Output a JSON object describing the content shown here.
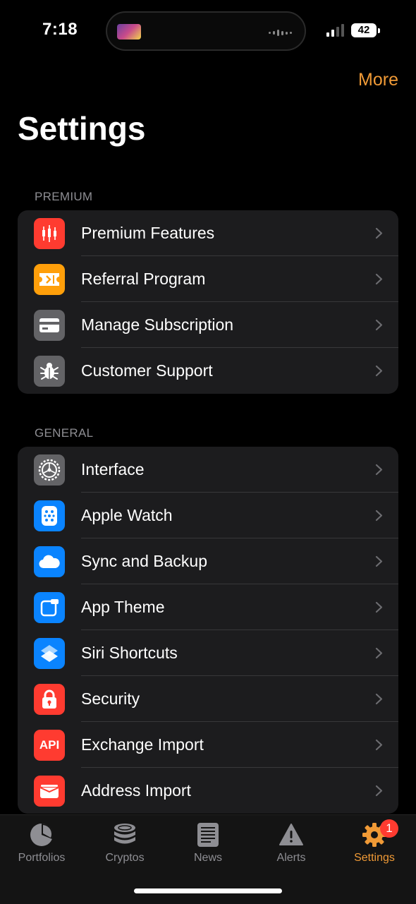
{
  "status_bar": {
    "time": "7:18",
    "battery": "42"
  },
  "header": {
    "more_label": "More",
    "title": "Settings"
  },
  "colors": {
    "accent": "#f09a36",
    "red": "#ff3b30",
    "orange": "#ff9f0a",
    "gray": "#636366",
    "blue": "#0a84ff"
  },
  "sections": {
    "premium": {
      "title": "PREMIUM",
      "items": [
        {
          "label": "Premium Features",
          "icon": "candlestick-chart-icon"
        },
        {
          "label": "Referral Program",
          "icon": "ticket-icon"
        },
        {
          "label": "Manage Subscription",
          "icon": "credit-card-icon"
        },
        {
          "label": "Customer Support",
          "icon": "bug-icon"
        }
      ]
    },
    "general": {
      "title": "GENERAL",
      "items": [
        {
          "label": "Interface",
          "icon": "gear-icon"
        },
        {
          "label": "Apple Watch",
          "icon": "watch-icon"
        },
        {
          "label": "Sync and Backup",
          "icon": "cloud-icon"
        },
        {
          "label": "App Theme",
          "icon": "theme-icon"
        },
        {
          "label": "Siri Shortcuts",
          "icon": "shortcuts-icon"
        },
        {
          "label": "Security",
          "icon": "lock-icon"
        },
        {
          "label": "Exchange Import",
          "icon": "api-icon",
          "icon_text": "API"
        },
        {
          "label": "Address Import",
          "icon": "wallet-icon"
        }
      ]
    }
  },
  "tab_bar": {
    "tabs": [
      {
        "label": "Portfolios",
        "icon": "pie-chart-icon"
      },
      {
        "label": "Cryptos",
        "icon": "coins-stack-icon"
      },
      {
        "label": "News",
        "icon": "newspaper-icon"
      },
      {
        "label": "Alerts",
        "icon": "warning-icon"
      },
      {
        "label": "Settings",
        "icon": "gear-icon",
        "active": true,
        "badge": "1"
      }
    ]
  }
}
